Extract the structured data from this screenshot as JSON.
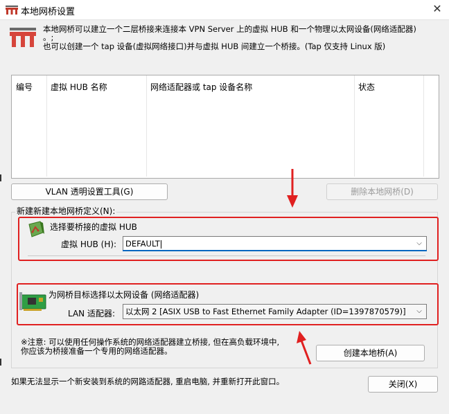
{
  "window": {
    "title": "本地网桥设置",
    "close_glyph": "✕"
  },
  "description": {
    "line1": "本地网桥可以建立一个二层桥接来连接本 VPN Server 上的虚拟 HUB 和一个物理以太网设备(网络适配器)",
    "line1b": "。;",
    "line2": "也可以创建一个 tap 设备(虚拟网络接口)并与虚拟 HUB 间建立一个桥接。(Tap 仅支持 Linux 版)"
  },
  "bridge_list": {
    "columns": [
      "编号",
      "虚拟 HUB 名称",
      "网络适配器或 tap 设备名称",
      "状态"
    ],
    "rows": []
  },
  "buttons": {
    "vlan": "VLAN 透明设置工具(G)",
    "delete": "删除本地网桥(D)",
    "create": "创建本地桥(A)",
    "close": "关闭(X)"
  },
  "new_bridge": {
    "group_title": "新建新建本地网桥定义(N):",
    "hub_section_title": "选择要桥接的虚拟 HUB",
    "hub_label": "虚拟 HUB (H):",
    "hub_value": "DEFAULT",
    "adapter_section_title": "为网桥目标选择以太网设备 (网络适配器)",
    "adapter_label": "LAN 适配器:",
    "adapter_value": "以太网 2 [ASIX USB to Fast Ethernet Family Adapter (ID=1397870579)]",
    "note_line1": "※注意: 可以使用任何操作系统的网络适配器建立桥接, 但在高负载环境中,",
    "note_line2": "你应该为桥接准备一个专用的网络适配器。"
  },
  "footer_text": "如果无法显示一个新安装到系统的网路适配器, 重启电脑, 并重新打开此窗口。",
  "colors": {
    "annotation_red": "#e02020",
    "focus_blue": "#0067c0"
  },
  "icons": {
    "app": "bridge-icon",
    "hub": "virtual-hub-icon",
    "adapter": "network-card-icon",
    "dropdown": "chevron-down-icon"
  }
}
